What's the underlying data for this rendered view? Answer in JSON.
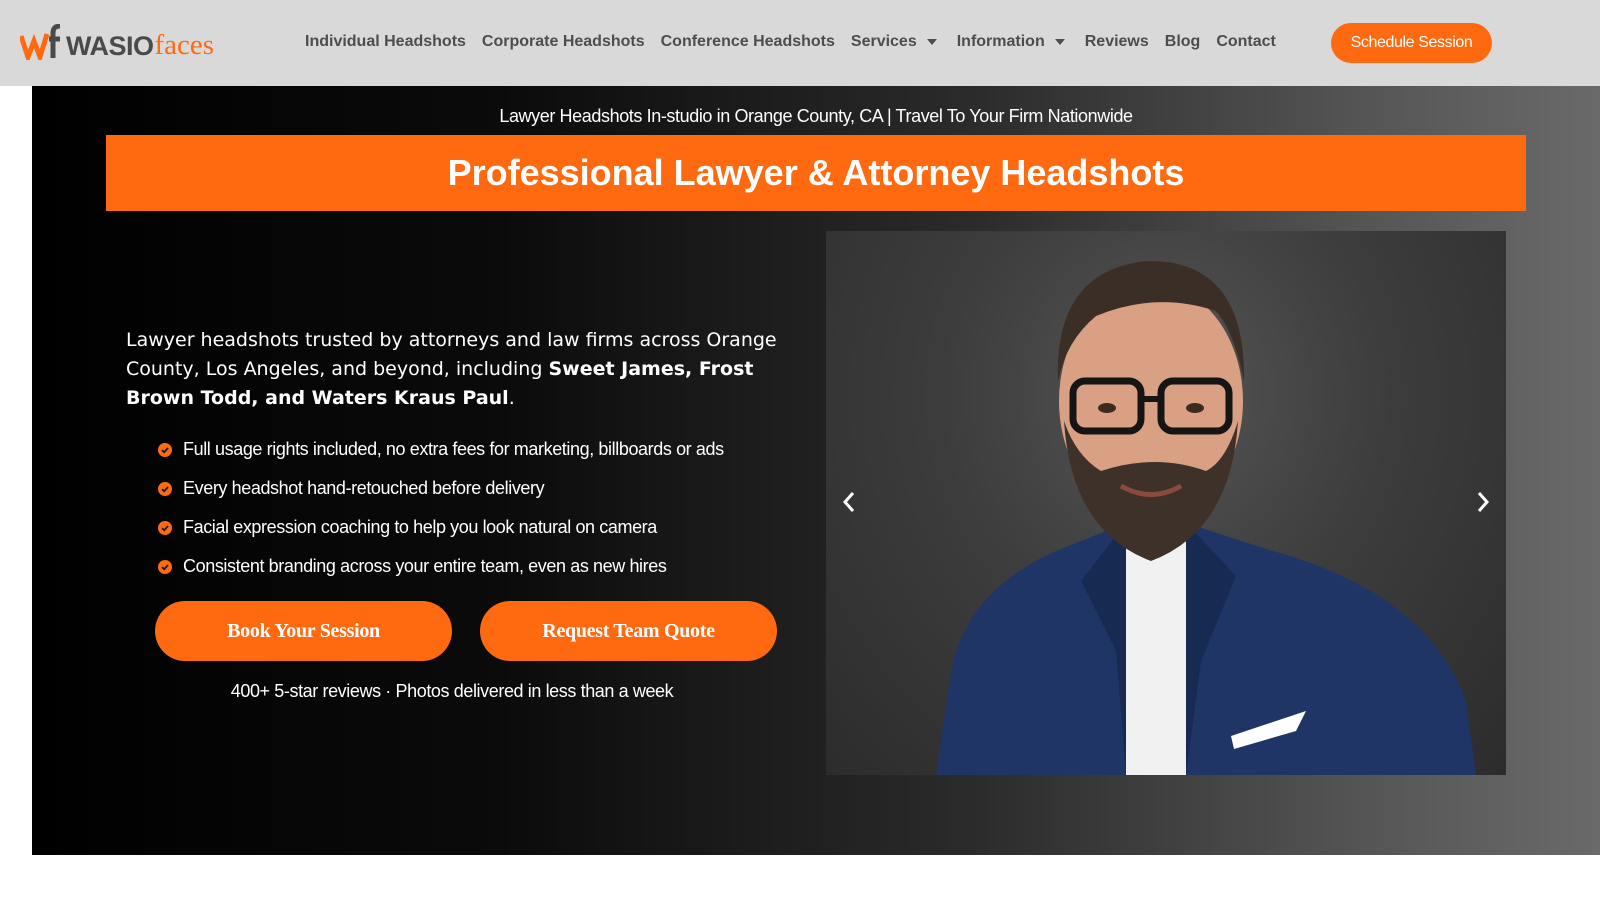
{
  "header": {
    "logo": {
      "mark": "wf",
      "word": "WASIO",
      "suffix": "faces"
    },
    "nav": [
      {
        "label": "Individual Headshots",
        "dropdown": false
      },
      {
        "label": "Corporate Headshots",
        "dropdown": false
      },
      {
        "label": "Conference Headshots",
        "dropdown": false
      },
      {
        "label": "Services",
        "dropdown": true
      },
      {
        "label": "Information",
        "dropdown": true
      },
      {
        "label": "Reviews",
        "dropdown": false
      },
      {
        "label": "Blog",
        "dropdown": false
      },
      {
        "label": "Contact",
        "dropdown": false
      }
    ],
    "cta_label": "Schedule Session"
  },
  "hero": {
    "subtitle": "Lawyer Headshots In-studio in Orange County, CA | Travel To Your Firm Nationwide",
    "title": "Professional Lawyer & Attorney Headshots",
    "intro": {
      "text_before": "Lawyer headshots trusted by attorneys and law firms across Orange County, Los Angeles, and beyond, including ",
      "clients_bold": "Sweet James, Frost Brown Todd, and Waters Kraus Paul",
      "text_after": "."
    },
    "features": [
      "Full usage rights included, no extra fees for marketing, billboards or ads",
      "Every headshot hand-retouched before delivery",
      "Facial expression coaching to help you look natural on camera",
      "Consistent branding across your entire team, even as new hires"
    ],
    "buttons": {
      "book": "Book Your Session",
      "quote": "Request Team Quote"
    },
    "social_proof": "400+ 5-star reviews · Photos delivered in less than a week"
  },
  "slider": {
    "prev_icon": "chevron-left-icon",
    "next_icon": "chevron-right-icon",
    "image": "lawyer-headshot-photo"
  },
  "colors": {
    "accent": "#ff6a10",
    "header_bg": "#d9d9d9",
    "nav_text": "#4d4d4d"
  }
}
